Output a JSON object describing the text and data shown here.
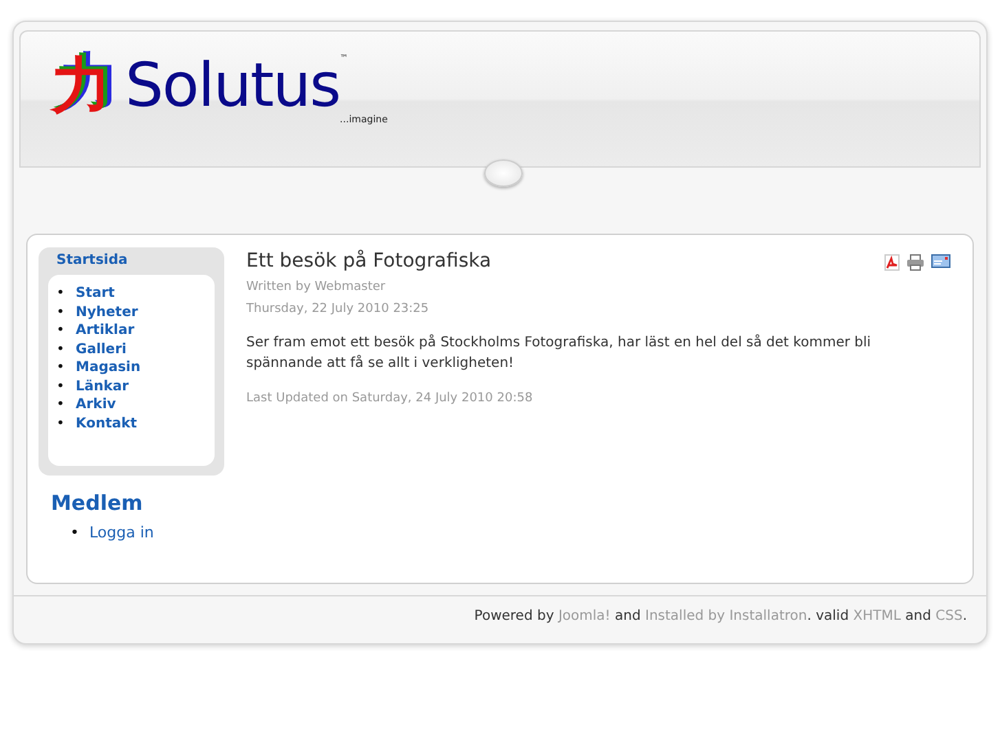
{
  "logo": {
    "glyph": "力",
    "name": "Solutus",
    "trademark": "™",
    "tagline": "...imagine"
  },
  "main_menu": {
    "title": "Startsida",
    "items": [
      {
        "bullet": "•",
        "label": "Start"
      },
      {
        "bullet": "•",
        "label": "Nyheter"
      },
      {
        "bullet": "•",
        "label": "Artiklar"
      },
      {
        "bullet": "•",
        "label": "Galleri"
      },
      {
        "bullet": "•",
        "label": "Magasin"
      },
      {
        "bullet": "•",
        "label": "Länkar"
      },
      {
        "bullet": "•",
        "label": "Arkiv"
      },
      {
        "bullet": "•",
        "label": "Kontakt"
      }
    ]
  },
  "member_module": {
    "title": "Medlem",
    "items": [
      {
        "bullet": "•",
        "label": "Logga in"
      }
    ]
  },
  "article": {
    "title": "Ett besök på Fotografiska",
    "author": "Written by Webmaster",
    "created": "Thursday, 22 July 2010 23:25",
    "body": "Ser fram emot ett besök på Stockholms Fotografiska, har läst en hel del så det kommer bli spännande att få se allt i verkligheten!",
    "modified": "Last Updated on Saturday, 24 July 2010 20:58",
    "actions": [
      {
        "kind": "pdf"
      },
      {
        "kind": "print"
      },
      {
        "kind": "email"
      }
    ]
  },
  "footer": [
    {
      "text": "Powered by",
      "link": false
    },
    {
      "text": "Joomla!",
      "link": true
    },
    {
      "text": "and",
      "link": false
    },
    {
      "text": "Installed by Installatron",
      "link": true
    },
    {
      "text": ". valid",
      "link": false
    },
    {
      "text": "XHTML",
      "link": true
    },
    {
      "text": "and",
      "link": false
    },
    {
      "text": "CSS",
      "link": true
    },
    {
      "text": ".",
      "link": false
    }
  ]
}
